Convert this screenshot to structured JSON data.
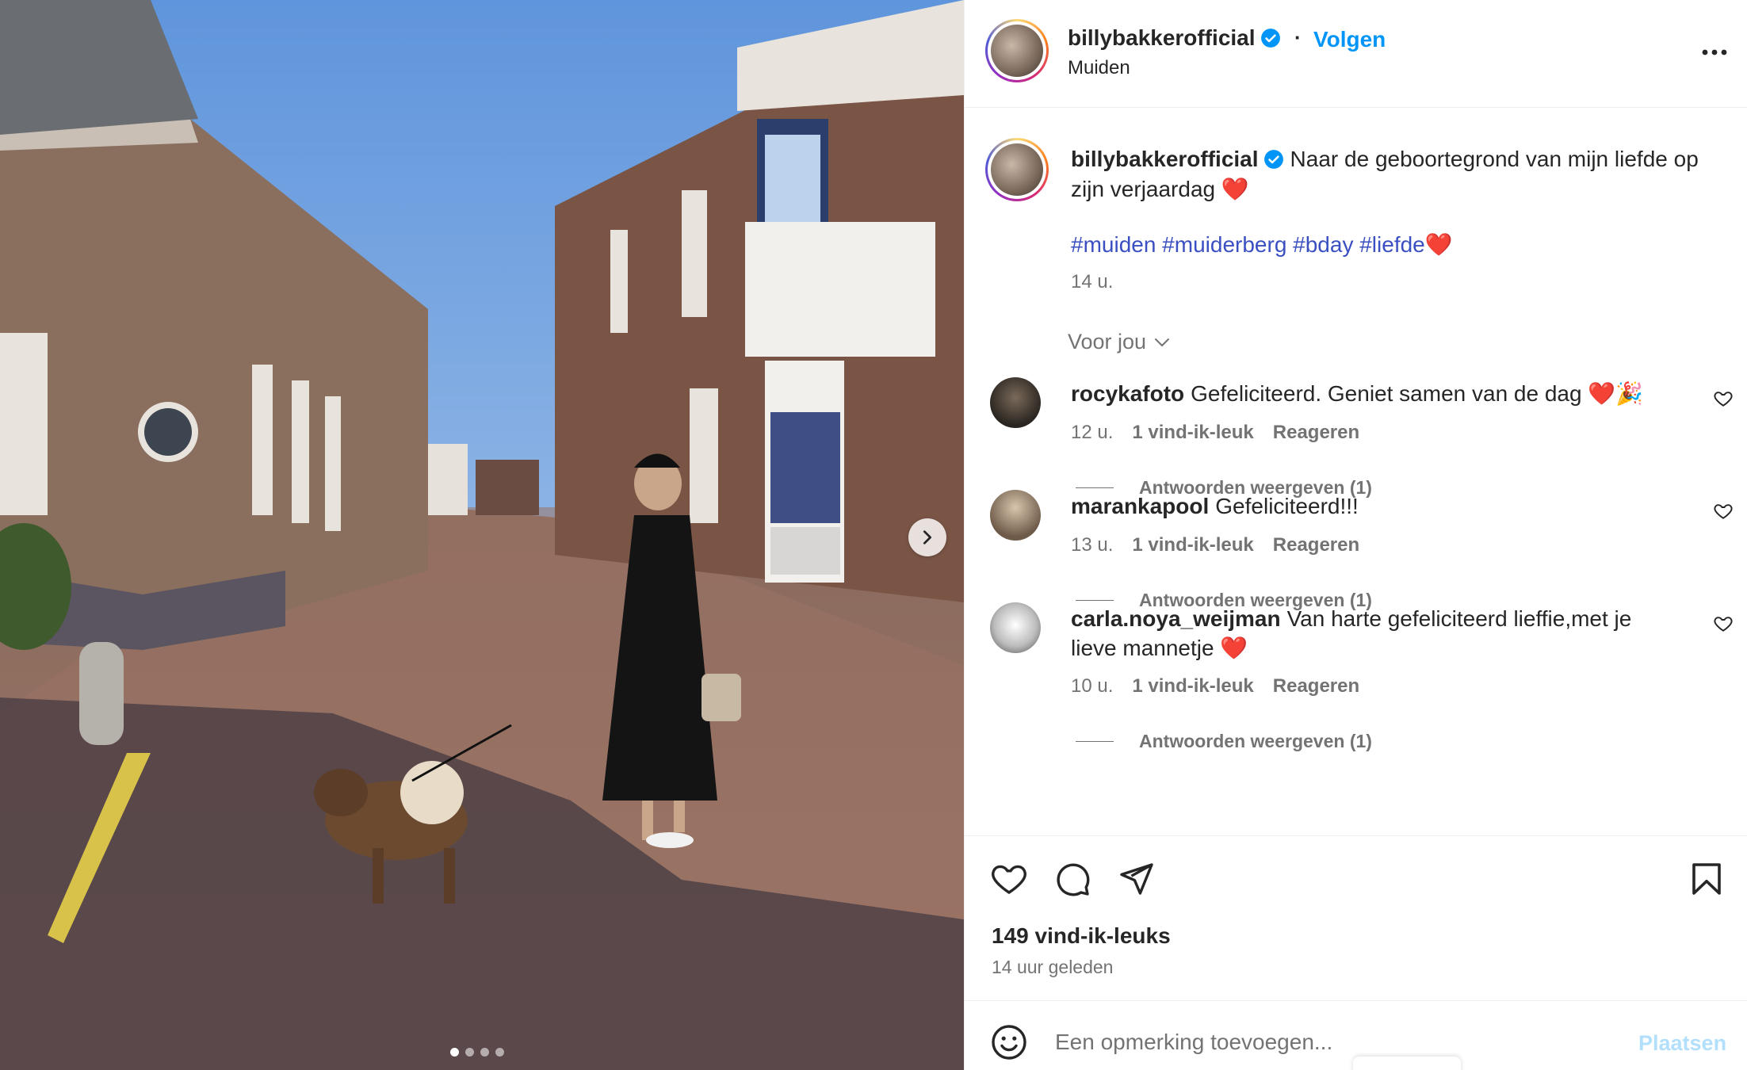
{
  "post": {
    "username": "billybakkerofficial",
    "follow_label": "Volgen",
    "location": "Muiden",
    "caption": "Naar de geboortegrond van mijn liefde op zijn verjaardag ❤️",
    "hashtags": "#muiden #muiderberg #bday #liefde❤️",
    "time": "14 u.",
    "for_you_label": "Voor jou",
    "likes": "149 vind-ik-leuks",
    "posted_ago": "14 uur geleden",
    "carousel": {
      "slides": 4,
      "active": 1
    }
  },
  "comments": [
    {
      "username": "rocykafoto",
      "text": "Gefeliciteerd. Geniet samen van de dag ❤️🎉",
      "time": "12 u.",
      "likes": "1 vind-ik-leuk",
      "reply_label": "Reageren",
      "replies_label": "Antwoorden weergeven (1)"
    },
    {
      "username": "marankapool",
      "text": "Gefeliciteerd!!!",
      "time": "13 u.",
      "likes": "1 vind-ik-leuk",
      "reply_label": "Reageren",
      "replies_label": "Antwoorden weergeven (1)"
    },
    {
      "username": "carla.noya_weijman",
      "text": "Van harte gefeliciteerd lieffie,met je lieve mannetje ❤️",
      "time": "10 u.",
      "likes": "1 vind-ik-leuk",
      "reply_label": "Reageren",
      "replies_label": "Antwoorden weergeven (1)"
    }
  ],
  "add_comment": {
    "placeholder": "Een opmerking toevoegen...",
    "post_label": "Plaatsen"
  },
  "colors": {
    "accent": "#0095f6",
    "hashtag": "#3a50c2",
    "muted": "#737373",
    "verified": "#0095f6"
  },
  "icons": [
    "verified-icon",
    "more-icon",
    "chevron-down-icon",
    "heart-icon",
    "comment-icon",
    "share-icon",
    "bookmark-icon",
    "emoji-icon",
    "chevron-right-icon"
  ]
}
